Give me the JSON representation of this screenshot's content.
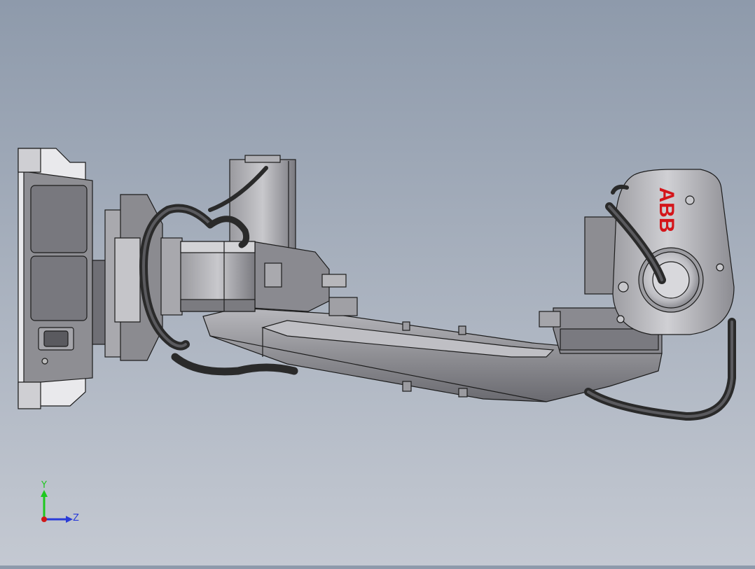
{
  "viewport": {
    "background_top": "#8e9aab",
    "background_bottom": "#c4c9d2",
    "model_body_color": "#8f8f94",
    "model_dark_color": "#5f5f64",
    "model_light_color": "#c9c9cd",
    "cable_color": "#2a2a2a",
    "edge_color": "#1c1c1c"
  },
  "model": {
    "brand_logo": "ABB",
    "brand_color": "#d4151a"
  },
  "triad": {
    "y_label": "Y",
    "z_label": "Z",
    "y_color": "#1ec81e",
    "z_color": "#2a3cd8",
    "x_color": "#d01818"
  }
}
